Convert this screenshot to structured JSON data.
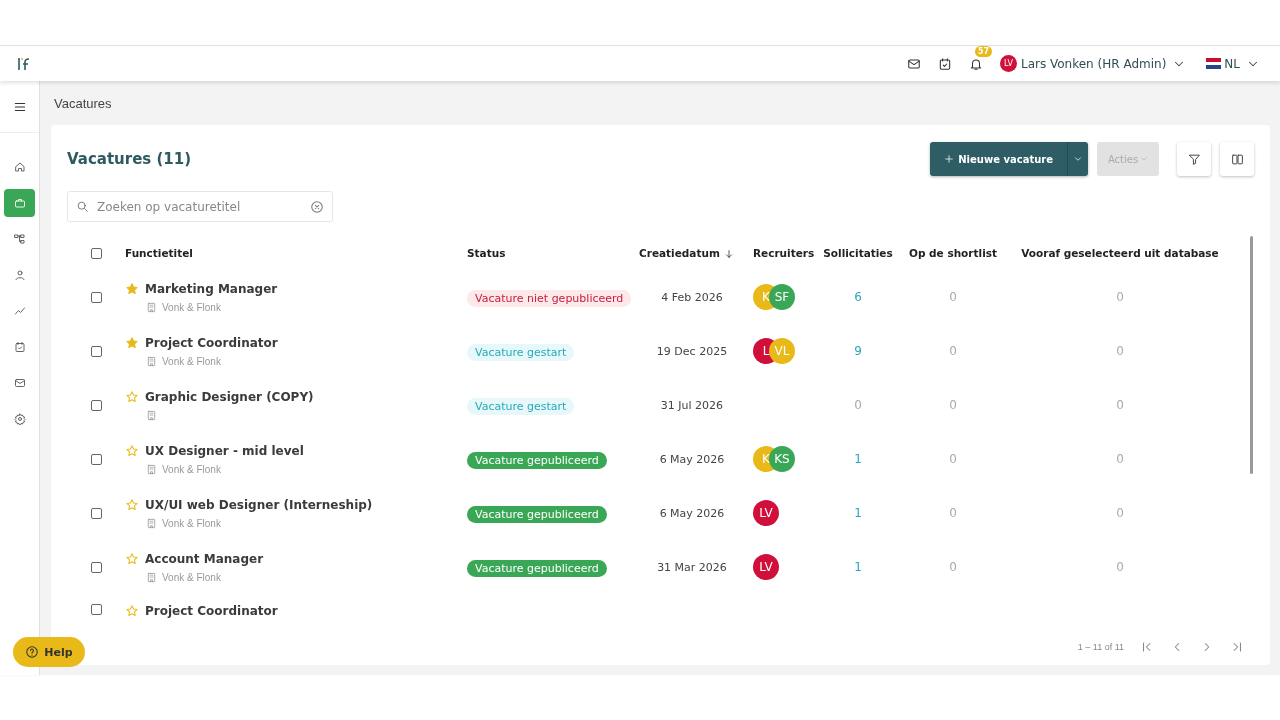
{
  "header": {
    "notifications": "57",
    "user": {
      "initials": "LV",
      "name": "Lars Vonken (HR Admin)"
    },
    "language": "NL"
  },
  "sidebar": {
    "items": [
      {
        "selected": false
      },
      {
        "selected": true
      },
      {
        "selected": false
      },
      {
        "selected": false
      },
      {
        "selected": false
      },
      {
        "selected": false
      },
      {
        "selected": false
      },
      {
        "selected": false
      }
    ]
  },
  "breadcrumb": "Vacatures",
  "card": {
    "title": "Vacatures (11)",
    "new_button": "Nieuwe vacature",
    "actions_button": {
      "label": "Acties",
      "disabled": true
    },
    "search": {
      "placeholder": "Zoeken op vacaturetitel"
    },
    "table": {
      "select_all": {
        "checked": false
      },
      "columns": [
        {
          "label": "Functietitel"
        },
        {
          "label": "Status"
        },
        {
          "label": "Creatiedatum",
          "sorted": true
        },
        {
          "label": "Recruiters"
        },
        {
          "label": "Sollicitaties"
        },
        {
          "label": "Op de shortlist"
        },
        {
          "label": "Vooraf geselecteerd uit database"
        }
      ],
      "rows": [
        {
          "checked": false,
          "starred": true,
          "title": "Marketing Manager",
          "company": "Vonk & Flonk",
          "status": {
            "kind": "unpublished",
            "label": "Vacature niet gepubliceerd"
          },
          "date": "4 Feb 2026",
          "recruiters": [
            {
              "initials": "K",
              "color": "#e9b919"
            },
            {
              "initials": "SF",
              "color": "#3aa757"
            }
          ],
          "applications": {
            "value": "6",
            "linked": true
          },
          "shortlist": "0",
          "preselected": "0"
        },
        {
          "checked": false,
          "starred": true,
          "title": "Project Coordinator",
          "company": "Vonk & Flonk",
          "status": {
            "kind": "started",
            "label": "Vacature gestart"
          },
          "date": "19 Dec 2025",
          "recruiters": [
            {
              "initials": "L",
              "color": "#d0103a"
            },
            {
              "initials": "VL",
              "color": "#e9b919"
            }
          ],
          "applications": {
            "value": "9",
            "linked": true
          },
          "shortlist": "0",
          "preselected": "0"
        },
        {
          "checked": false,
          "starred": false,
          "title": "Graphic Designer (COPY)",
          "status": {
            "kind": "started",
            "label": "Vacature gestart"
          },
          "date": "31 Jul 2026",
          "recruiters": [],
          "applications": {
            "value": "0",
            "linked": false
          },
          "shortlist": "0",
          "preselected": "0"
        },
        {
          "checked": false,
          "starred": false,
          "title": "UX Designer - mid level",
          "company": "Vonk & Flonk",
          "status": {
            "kind": "published",
            "label": "Vacature gepubliceerd"
          },
          "date": "6 May 2026",
          "recruiters": [
            {
              "initials": "K",
              "color": "#e9b919"
            },
            {
              "initials": "KS",
              "color": "#3aa757"
            }
          ],
          "applications": {
            "value": "1",
            "linked": true
          },
          "shortlist": "0",
          "preselected": "0"
        },
        {
          "checked": false,
          "starred": false,
          "title": "UX/UI web Designer (Interneship)",
          "company": "Vonk & Flonk",
          "status": {
            "kind": "published",
            "label": "Vacature gepubliceerd"
          },
          "date": "6 May 2026",
          "recruiters": [
            {
              "initials": "LV",
              "color": "#d0103a"
            }
          ],
          "applications": {
            "value": "1",
            "linked": true
          },
          "shortlist": "0",
          "preselected": "0"
        },
        {
          "checked": false,
          "starred": false,
          "title": "Account Manager",
          "company": "Vonk & Flonk",
          "status": {
            "kind": "published",
            "label": "Vacature gepubliceerd"
          },
          "date": "31 Mar 2026",
          "recruiters": [
            {
              "initials": "LV",
              "color": "#d0103a"
            }
          ],
          "applications": {
            "value": "1",
            "linked": true
          },
          "shortlist": "0",
          "preselected": "0"
        },
        {
          "checked": false,
          "starred": false,
          "title": "Project Coordinator"
        }
      ]
    },
    "pagination": "1 – 11 of 11"
  },
  "help_button": "Help"
}
